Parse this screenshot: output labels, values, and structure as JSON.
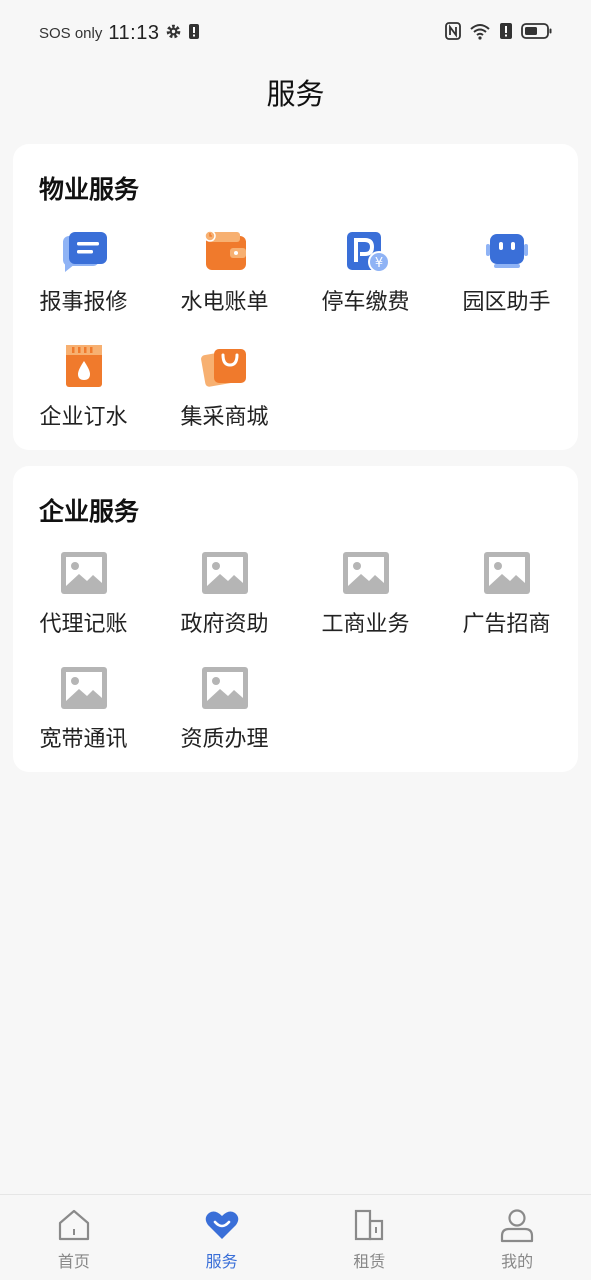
{
  "status_bar": {
    "carrier": "SOS only",
    "time": "11:13"
  },
  "header": {
    "title": "服务"
  },
  "property_services": {
    "title": "物业服务",
    "items": [
      {
        "label": "报事报修",
        "icon": "chat-message-icon"
      },
      {
        "label": "水电账单",
        "icon": "wallet-icon"
      },
      {
        "label": "停车缴费",
        "icon": "parking-payment-icon"
      },
      {
        "label": "园区助手",
        "icon": "robot-assistant-icon"
      },
      {
        "label": "企业订水",
        "icon": "water-drop-icon"
      },
      {
        "label": "集采商城",
        "icon": "shopping-bag-icon"
      }
    ]
  },
  "enterprise_services": {
    "title": "企业服务",
    "items": [
      {
        "label": "代理记账",
        "icon": "image-placeholder-icon"
      },
      {
        "label": "政府资助",
        "icon": "image-placeholder-icon"
      },
      {
        "label": "工商业务",
        "icon": "image-placeholder-icon"
      },
      {
        "label": "广告招商",
        "icon": "image-placeholder-icon"
      },
      {
        "label": "宽带通讯",
        "icon": "image-placeholder-icon"
      },
      {
        "label": "资质办理",
        "icon": "image-placeholder-icon"
      }
    ]
  },
  "tab_bar": {
    "tabs": [
      {
        "label": "首页",
        "icon": "home-icon",
        "active": false
      },
      {
        "label": "服务",
        "icon": "heart-service-icon",
        "active": true
      },
      {
        "label": "租赁",
        "icon": "building-icon",
        "active": false
      },
      {
        "label": "我的",
        "icon": "user-icon",
        "active": false
      }
    ]
  },
  "colors": {
    "accent": "#3a6fd8",
    "orange": "#f07a2c",
    "placeholder_gray": "#b5b5b5"
  }
}
